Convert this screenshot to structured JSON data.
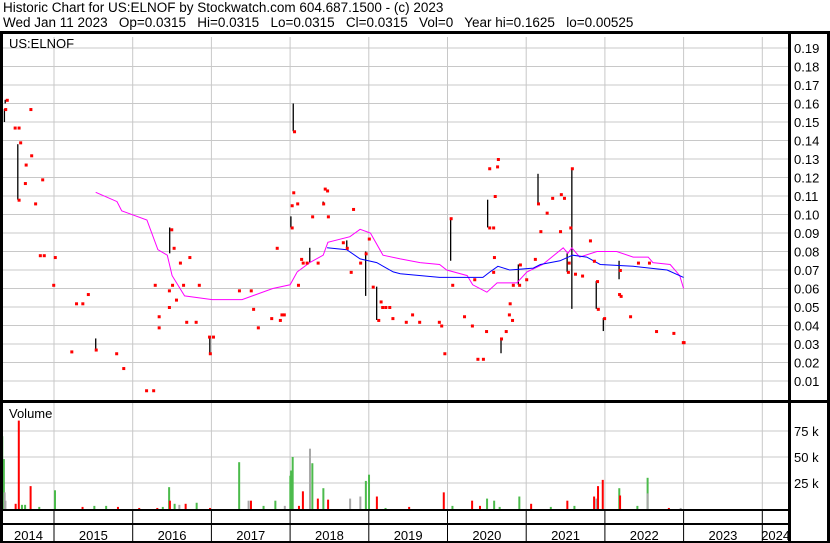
{
  "header": {
    "title": "Historic Chart for US:ELNOF by Stockwatch.com 604.687.1500 - (c) 2023",
    "quote": "Wed Jan 11 2023   Op=0.0315   Hi=0.0315   Lo=0.0315   Cl=0.0315   Vol=0   Year hi=0.1625   lo=0.00525"
  },
  "chart_data": {
    "type": "scatter",
    "symbol": "US:ELNOF",
    "volume_label": "Volume",
    "x_range": [
      2014.31,
      2024.35
    ],
    "year_ticks": [
      "2014",
      "2015",
      "2016",
      "2017",
      "2018",
      "2019",
      "2020",
      "2021",
      "2022",
      "2023",
      "2024"
    ],
    "price_axis": {
      "ylim": [
        0,
        0.195
      ],
      "ticks": [
        "0.01",
        "0.02",
        "0.03",
        "0.04",
        "0.05",
        "0.06",
        "0.07",
        "0.08",
        "0.09",
        "0.10",
        "0.11",
        "0.12",
        "0.13",
        "0.14",
        "0.15",
        "0.16",
        "0.17",
        "0.18",
        "0.19"
      ]
    },
    "volume_axis": {
      "ylim": [
        0,
        100
      ],
      "unit": "k",
      "ticks": [
        "25 k",
        "50 k",
        "75 k"
      ]
    },
    "colors": {
      "close": "#ff0000",
      "range": "#000000",
      "ma_short": "#ff00ff",
      "ma_long": "#0000ff",
      "vol_up": "#4cbb4c",
      "vol_down": "#ff0000",
      "vol_flat": "#a8a8a8",
      "grid": "#c8c8c8"
    },
    "closes": [
      [
        2014.4,
        0.162
      ],
      [
        2014.38,
        0.157
      ],
      [
        2014.7,
        0.157
      ],
      [
        2014.5,
        0.147
      ],
      [
        2014.55,
        0.147
      ],
      [
        2014.57,
        0.139
      ],
      [
        2014.71,
        0.132
      ],
      [
        2014.64,
        0.127
      ],
      [
        2014.85,
        0.119
      ],
      [
        2014.63,
        0.117
      ],
      [
        2014.55,
        0.108
      ],
      [
        2014.76,
        0.106
      ],
      [
        2014.82,
        0.078
      ],
      [
        2014.87,
        0.078
      ],
      [
        2015.01,
        0.077
      ],
      [
        2014.99,
        0.062
      ],
      [
        2015.43,
        0.057
      ],
      [
        2015.28,
        0.052
      ],
      [
        2015.36,
        0.052
      ],
      [
        2015.22,
        0.026
      ],
      [
        2015.53,
        0.027
      ],
      [
        2015.79,
        0.025
      ],
      [
        2015.88,
        0.017
      ],
      [
        2016.17,
        0.005
      ],
      [
        2016.26,
        0.005
      ],
      [
        2016.49,
        0.092
      ],
      [
        2016.52,
        0.082
      ],
      [
        2016.6,
        0.074
      ],
      [
        2016.72,
        0.077
      ],
      [
        2016.28,
        0.062
      ],
      [
        2016.5,
        0.062
      ],
      [
        2016.64,
        0.062
      ],
      [
        2016.84,
        0.062
      ],
      [
        2016.46,
        0.059
      ],
      [
        2016.55,
        0.054
      ],
      [
        2016.46,
        0.05
      ],
      [
        2016.33,
        0.045
      ],
      [
        2016.33,
        0.039
      ],
      [
        2016.68,
        0.042
      ],
      [
        2016.8,
        0.042
      ],
      [
        2016.97,
        0.034
      ],
      [
        2017.02,
        0.034
      ],
      [
        2016.98,
        0.025
      ],
      [
        2017.35,
        0.059
      ],
      [
        2017.5,
        0.059
      ],
      [
        2017.53,
        0.049
      ],
      [
        2017.59,
        0.039
      ],
      [
        2017.76,
        0.044
      ],
      [
        2017.89,
        0.046
      ],
      [
        2017.92,
        0.046
      ],
      [
        2017.87,
        0.043
      ],
      [
        2017.83,
        0.082
      ],
      [
        2018.05,
        0.145
      ],
      [
        2018.04,
        0.112
      ],
      [
        2018.09,
        0.106
      ],
      [
        2018.02,
        0.105
      ],
      [
        2018.02,
        0.093
      ],
      [
        2018.28,
        0.099
      ],
      [
        2018.48,
        0.099
      ],
      [
        2018.44,
        0.114
      ],
      [
        2018.47,
        0.113
      ],
      [
        2018.42,
        0.106
      ],
      [
        2018.8,
        0.103
      ],
      [
        2019.0,
        0.087
      ],
      [
        2018.89,
        0.074
      ],
      [
        2018.77,
        0.069
      ],
      [
        2018.72,
        0.082
      ],
      [
        2018.67,
        0.085
      ],
      [
        2018.35,
        0.074
      ],
      [
        2018.21,
        0.074
      ],
      [
        2018.16,
        0.074
      ],
      [
        2018.14,
        0.076
      ],
      [
        2018.1,
        0.062
      ],
      [
        2018.96,
        0.079
      ],
      [
        2019.05,
        0.061
      ],
      [
        2019.15,
        0.053
      ],
      [
        2019.17,
        0.05
      ],
      [
        2019.21,
        0.05
      ],
      [
        2019.26,
        0.05
      ],
      [
        2019.3,
        0.044
      ],
      [
        2019.12,
        0.043
      ],
      [
        2019.47,
        0.042
      ],
      [
        2019.55,
        0.046
      ],
      [
        2019.64,
        0.042
      ],
      [
        2019.89,
        0.042
      ],
      [
        2019.92,
        0.04
      ],
      [
        2019.96,
        0.025
      ],
      [
        2020.04,
        0.098
      ],
      [
        2020.06,
        0.062
      ],
      [
        2020.21,
        0.045
      ],
      [
        2020.31,
        0.04
      ],
      [
        2020.38,
        0.022
      ],
      [
        2020.45,
        0.022
      ],
      [
        2020.49,
        0.037
      ],
      [
        2020.74,
        0.037
      ],
      [
        2020.53,
        0.125
      ],
      [
        2020.64,
        0.13
      ],
      [
        2020.63,
        0.126
      ],
      [
        2020.6,
        0.11
      ],
      [
        2020.53,
        0.093
      ],
      [
        2020.58,
        0.093
      ],
      [
        2020.59,
        0.077
      ],
      [
        2020.34,
        0.065
      ],
      [
        2020.58,
        0.069
      ],
      [
        2020.68,
        0.033
      ],
      [
        2020.78,
        0.046
      ],
      [
        2020.82,
        0.043
      ],
      [
        2020.79,
        0.052
      ],
      [
        2020.83,
        0.062
      ],
      [
        2020.91,
        0.062
      ],
      [
        2021.0,
        0.065
      ],
      [
        2020.92,
        0.073
      ],
      [
        2021.11,
        0.076
      ],
      [
        2021.15,
        0.106
      ],
      [
        2021.26,
        0.101
      ],
      [
        2021.33,
        0.109
      ],
      [
        2021.44,
        0.111
      ],
      [
        2021.48,
        0.109
      ],
      [
        2021.18,
        0.091
      ],
      [
        2021.43,
        0.091
      ],
      [
        2021.56,
        0.093
      ],
      [
        2021.54,
        0.074
      ],
      [
        2021.62,
        0.068
      ],
      [
        2021.71,
        0.067
      ],
      [
        2021.81,
        0.086
      ],
      [
        2021.86,
        0.075
      ],
      [
        2021.58,
        0.125
      ],
      [
        2021.53,
        0.069
      ],
      [
        2021.91,
        0.049
      ],
      [
        2021.99,
        0.044
      ],
      [
        2021.9,
        0.064
      ],
      [
        2022.18,
        0.057
      ],
      [
        2022.2,
        0.056
      ],
      [
        2022.19,
        0.07
      ],
      [
        2022.32,
        0.045
      ],
      [
        2022.42,
        0.074
      ],
      [
        2022.56,
        0.074
      ],
      [
        2022.65,
        0.037
      ],
      [
        2022.87,
        0.036
      ],
      [
        2022.99,
        0.031
      ],
      [
        2023.0,
        0.031
      ]
    ],
    "ranges": [
      [
        2014.38,
        0.162,
        0.16
      ],
      [
        2014.37,
        0.157,
        0.15
      ],
      [
        2014.54,
        0.138,
        0.108
      ],
      [
        2015.53,
        0.033,
        0.027
      ],
      [
        2016.47,
        0.093,
        0.079
      ],
      [
        2016.98,
        0.034,
        0.025
      ],
      [
        2018.04,
        0.16,
        0.145
      ],
      [
        2018.01,
        0.099,
        0.093
      ],
      [
        2018.25,
        0.082,
        0.074
      ],
      [
        2018.42,
        0.107,
        0.105
      ],
      [
        2018.72,
        0.086,
        0.082
      ],
      [
        2018.96,
        0.08,
        0.056
      ],
      [
        2019.1,
        0.061,
        0.043
      ],
      [
        2020.04,
        0.098,
        0.075
      ],
      [
        2020.51,
        0.108,
        0.093
      ],
      [
        2020.68,
        0.033,
        0.025
      ],
      [
        2020.9,
        0.073,
        0.062
      ],
      [
        2021.15,
        0.122,
        0.106
      ],
      [
        2021.52,
        0.079,
        0.069
      ],
      [
        2021.58,
        0.125,
        0.049
      ],
      [
        2021.89,
        0.064,
        0.049
      ],
      [
        2021.98,
        0.044,
        0.037
      ],
      [
        2022.18,
        0.075,
        0.065
      ]
    ],
    "ma_short": [
      [
        2015.53,
        0.112
      ],
      [
        2015.8,
        0.107
      ],
      [
        2015.86,
        0.102
      ],
      [
        2016.18,
        0.097
      ],
      [
        2016.32,
        0.081
      ],
      [
        2016.44,
        0.078
      ],
      [
        2016.5,
        0.067
      ],
      [
        2016.66,
        0.056
      ],
      [
        2017.01,
        0.054
      ],
      [
        2017.39,
        0.054
      ],
      [
        2017.78,
        0.06
      ],
      [
        2018.0,
        0.062
      ],
      [
        2018.09,
        0.069
      ],
      [
        2018.25,
        0.074
      ],
      [
        2018.42,
        0.078
      ],
      [
        2018.48,
        0.085
      ],
      [
        2018.76,
        0.088
      ],
      [
        2018.89,
        0.092
      ],
      [
        2019.02,
        0.09
      ],
      [
        2019.18,
        0.078
      ],
      [
        2019.4,
        0.076
      ],
      [
        2019.65,
        0.074
      ],
      [
        2019.9,
        0.073
      ],
      [
        2019.99,
        0.07
      ],
      [
        2020.25,
        0.067
      ],
      [
        2020.32,
        0.062
      ],
      [
        2020.5,
        0.058
      ],
      [
        2020.63,
        0.063
      ],
      [
        2020.88,
        0.063
      ],
      [
        2021.01,
        0.069
      ],
      [
        2021.21,
        0.073
      ],
      [
        2021.47,
        0.082
      ],
      [
        2021.53,
        0.079
      ],
      [
        2021.58,
        0.082
      ],
      [
        2021.68,
        0.077
      ],
      [
        2021.9,
        0.08
      ],
      [
        2022.15,
        0.08
      ],
      [
        2022.36,
        0.077
      ],
      [
        2022.55,
        0.077
      ],
      [
        2022.61,
        0.074
      ],
      [
        2022.83,
        0.073
      ],
      [
        2022.95,
        0.067
      ],
      [
        2023.0,
        0.06
      ]
    ],
    "ma_long": [
      [
        2018.47,
        0.082
      ],
      [
        2018.72,
        0.081
      ],
      [
        2018.89,
        0.076
      ],
      [
        2019.1,
        0.074
      ],
      [
        2019.31,
        0.069
      ],
      [
        2019.4,
        0.068
      ],
      [
        2019.9,
        0.066
      ],
      [
        2020.45,
        0.066
      ],
      [
        2020.54,
        0.069
      ],
      [
        2020.64,
        0.072
      ],
      [
        2020.79,
        0.07
      ],
      [
        2021.09,
        0.071
      ],
      [
        2021.18,
        0.073
      ],
      [
        2021.43,
        0.075
      ],
      [
        2021.59,
        0.078
      ],
      [
        2021.77,
        0.077
      ],
      [
        2021.94,
        0.073
      ],
      [
        2022.36,
        0.072
      ],
      [
        2022.79,
        0.07
      ],
      [
        2023.0,
        0.066
      ]
    ],
    "volume_k": [
      [
        2014.33,
        70,
        "up"
      ],
      [
        2014.35,
        48,
        "up"
      ],
      [
        2014.36,
        16,
        "flat"
      ],
      [
        2014.37,
        8,
        "flat"
      ],
      [
        2014.54,
        85,
        "down"
      ],
      [
        2014.5,
        5,
        "down"
      ],
      [
        2014.58,
        4,
        "up"
      ],
      [
        2014.62,
        4,
        "up"
      ],
      [
        2014.69,
        22,
        "down"
      ],
      [
        2014.8,
        2,
        "up"
      ],
      [
        2015.0,
        18,
        "up"
      ],
      [
        2015.35,
        2,
        "down"
      ],
      [
        2015.5,
        3,
        "up"
      ],
      [
        2015.65,
        3,
        "up"
      ],
      [
        2015.8,
        2,
        "down"
      ],
      [
        2016.07,
        1,
        "down"
      ],
      [
        2016.3,
        1,
        "down"
      ],
      [
        2016.37,
        2,
        "up"
      ],
      [
        2016.45,
        21,
        "up"
      ],
      [
        2016.46,
        8,
        "down"
      ],
      [
        2016.52,
        5,
        "up"
      ],
      [
        2016.58,
        4,
        "flat"
      ],
      [
        2016.66,
        5,
        "down"
      ],
      [
        2016.8,
        6,
        "up"
      ],
      [
        2016.97,
        1,
        "down"
      ],
      [
        2017.34,
        45,
        "up"
      ],
      [
        2017.46,
        8,
        "flat"
      ],
      [
        2017.49,
        8,
        "down"
      ],
      [
        2017.65,
        3,
        "up"
      ],
      [
        2017.8,
        8,
        "up"
      ],
      [
        2017.92,
        3,
        "flat"
      ],
      [
        2017.99,
        32,
        "up"
      ],
      [
        2018.0,
        37,
        "up"
      ],
      [
        2018.02,
        50,
        "up"
      ],
      [
        2018.1,
        3,
        "down"
      ],
      [
        2018.15,
        17,
        "down"
      ],
      [
        2018.24,
        58,
        "flat"
      ],
      [
        2018.27,
        44,
        "up"
      ],
      [
        2018.34,
        10,
        "down"
      ],
      [
        2018.41,
        20,
        "up"
      ],
      [
        2018.47,
        9,
        "down"
      ],
      [
        2018.75,
        10,
        "flat"
      ],
      [
        2018.88,
        12,
        "flat"
      ],
      [
        2018.95,
        27,
        "up"
      ],
      [
        2018.99,
        33,
        "up"
      ],
      [
        2019.09,
        12,
        "down"
      ],
      [
        2019.2,
        1,
        "up"
      ],
      [
        2019.5,
        2,
        "down"
      ],
      [
        2019.94,
        16,
        "down"
      ],
      [
        2020.05,
        3,
        "up"
      ],
      [
        2020.3,
        8,
        "down"
      ],
      [
        2020.4,
        3,
        "down"
      ],
      [
        2020.49,
        10,
        "up"
      ],
      [
        2020.58,
        8,
        "up"
      ],
      [
        2020.65,
        2,
        "up"
      ],
      [
        2020.9,
        12,
        "up"
      ],
      [
        2021.05,
        5,
        "down"
      ],
      [
        2021.3,
        2,
        "up"
      ],
      [
        2021.51,
        8,
        "down"
      ],
      [
        2021.6,
        3,
        "up"
      ],
      [
        2021.85,
        12,
        "down"
      ],
      [
        2021.88,
        10,
        "flat"
      ],
      [
        2021.9,
        22,
        "down"
      ],
      [
        2021.96,
        28,
        "down"
      ],
      [
        2022.17,
        20,
        "up"
      ],
      [
        2022.18,
        13,
        "down"
      ],
      [
        2022.4,
        3,
        "up"
      ],
      [
        2022.53,
        30,
        "up"
      ],
      [
        2022.53,
        15,
        "flat"
      ],
      [
        2022.8,
        1,
        "down"
      ],
      [
        2022.95,
        1,
        "flat"
      ]
    ]
  }
}
